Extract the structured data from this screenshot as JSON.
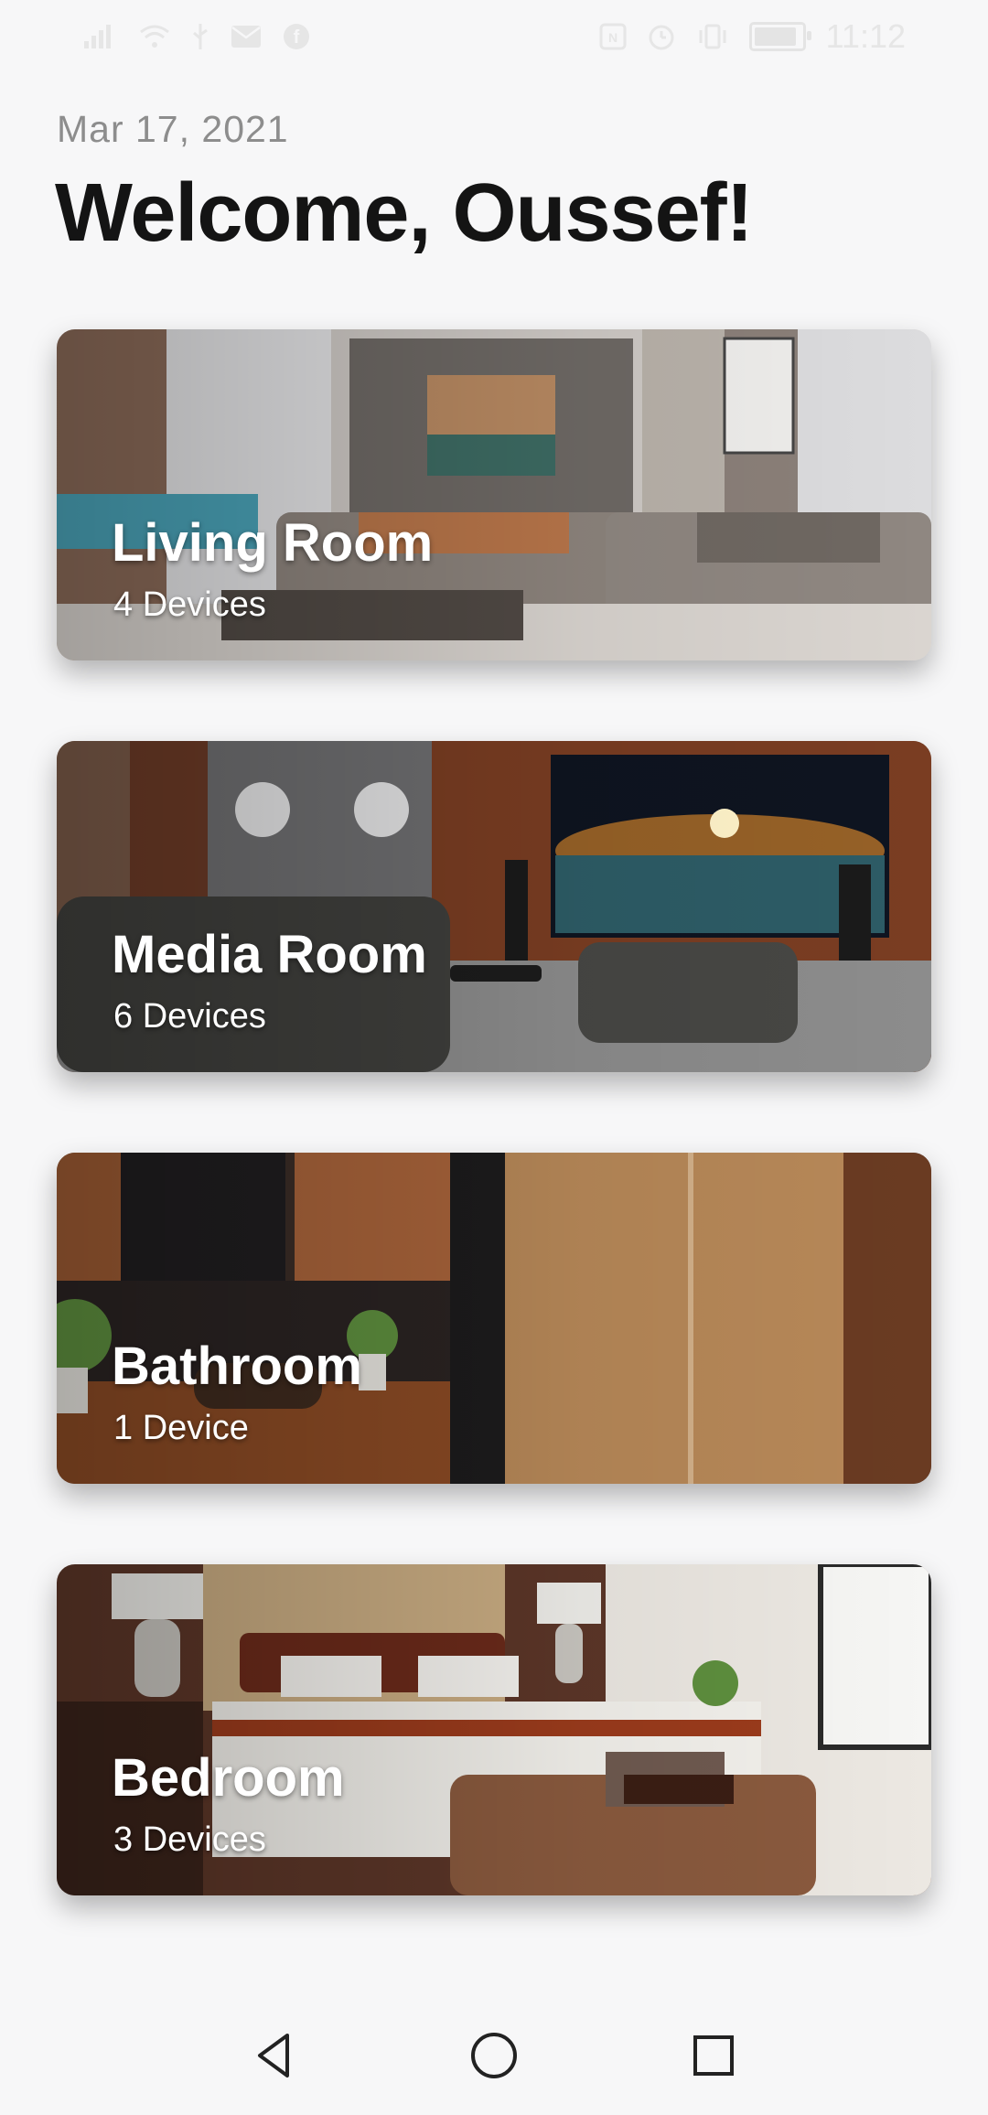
{
  "status_bar": {
    "time": "11:12",
    "battery_level": 0.9,
    "left_icons": [
      "signal-icon",
      "wifi-icon",
      "usb-icon",
      "mail-icon",
      "messenger-icon"
    ],
    "right_icons": [
      "nfc-icon",
      "alarm-icon",
      "vibrate-icon",
      "battery-icon"
    ]
  },
  "header": {
    "date": "Mar 17, 2021",
    "greeting": "Welcome, Oussef!"
  },
  "rooms": [
    {
      "name": "Living Room",
      "devices": "4 Devices",
      "image": "living-room-photo"
    },
    {
      "name": "Media Room",
      "devices": "6 Devices",
      "image": "media-room-photo"
    },
    {
      "name": "Bathroom",
      "devices": "1 Device",
      "image": "bathroom-photo"
    },
    {
      "name": "Bedroom",
      "devices": "3 Devices",
      "image": "bedroom-photo"
    }
  ],
  "nav_bar": {
    "icons": [
      "back-icon",
      "home-icon",
      "recents-icon"
    ]
  },
  "colors": {
    "background": "#f7f7f8",
    "title": "#141414",
    "date": "#8d8d8d",
    "card_text": "#ffffff"
  }
}
